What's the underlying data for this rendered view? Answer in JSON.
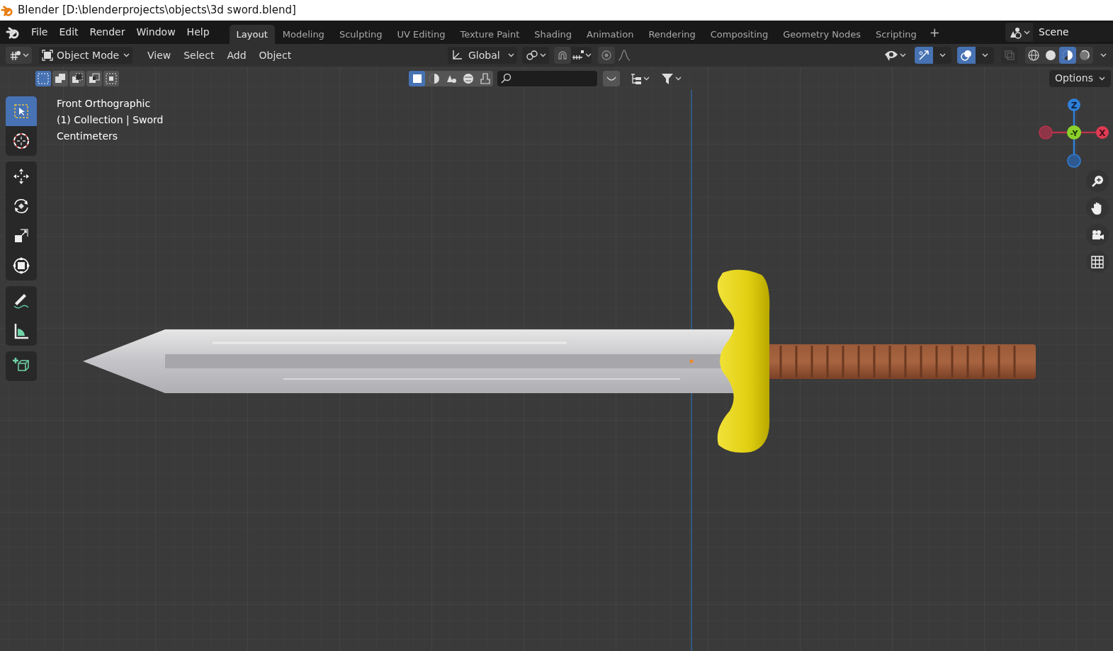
{
  "window": {
    "title": "Blender [D:\\blenderprojects\\objects\\3d sword.blend]"
  },
  "menu": [
    "File",
    "Edit",
    "Render",
    "Window",
    "Help"
  ],
  "workspace_tabs": [
    {
      "label": "Layout",
      "selected": true
    },
    {
      "label": "Modeling",
      "selected": false
    },
    {
      "label": "Sculpting",
      "selected": false
    },
    {
      "label": "UV Editing",
      "selected": false
    },
    {
      "label": "Texture Paint",
      "selected": false
    },
    {
      "label": "Shading",
      "selected": false
    },
    {
      "label": "Animation",
      "selected": false
    },
    {
      "label": "Rendering",
      "selected": false
    },
    {
      "label": "Compositing",
      "selected": false
    },
    {
      "label": "Geometry Nodes",
      "selected": false
    },
    {
      "label": "Scripting",
      "selected": false
    }
  ],
  "add_workspace": "+",
  "scene": {
    "value": "Scene"
  },
  "header": {
    "mode": "Object Mode",
    "menus": [
      "View",
      "Select",
      "Add",
      "Object"
    ],
    "orientation": "Global",
    "snap": {
      "on": false
    },
    "proportional_editing": {
      "on": false
    },
    "gizmos": {
      "on": true
    },
    "overlays": {
      "on": true
    },
    "xray": {
      "on": false
    },
    "shading_modes": [
      {
        "kind": "wireframe",
        "selected": false
      },
      {
        "kind": "solid",
        "selected": false
      },
      {
        "kind": "material",
        "selected": true
      },
      {
        "kind": "rendered",
        "selected": false
      }
    ]
  },
  "tool_settings": {
    "select_modes": [
      {
        "kind": "new",
        "selected": true
      },
      {
        "kind": "extend",
        "selected": false
      },
      {
        "kind": "subtract",
        "selected": false
      },
      {
        "kind": "invert",
        "selected": false
      },
      {
        "kind": "intersect",
        "selected": false
      }
    ],
    "outliner_filters": [
      {
        "kind": "mesh",
        "selected": true
      },
      {
        "kind": "material",
        "selected": false
      },
      {
        "kind": "light",
        "selected": false
      },
      {
        "kind": "world",
        "selected": false
      },
      {
        "kind": "paint",
        "selected": false
      }
    ],
    "options": "Options"
  },
  "viewport": {
    "info": [
      "Front Orthographic",
      "(1) Collection | Sword",
      "Centimeters"
    ],
    "gizmo_axes": [
      "Z",
      "-Y",
      "X"
    ]
  },
  "toolbar": [
    [
      {
        "kind": "select-box",
        "selected": true
      },
      {
        "kind": "cursor",
        "selected": false
      }
    ],
    [
      {
        "kind": "move",
        "selected": false
      },
      {
        "kind": "rotate",
        "selected": false
      },
      {
        "kind": "scale",
        "selected": false
      },
      {
        "kind": "transform",
        "selected": false
      }
    ],
    [
      {
        "kind": "annotate",
        "selected": false
      },
      {
        "kind": "measure",
        "selected": false
      }
    ],
    [
      {
        "kind": "add-cube",
        "selected": false
      }
    ]
  ]
}
